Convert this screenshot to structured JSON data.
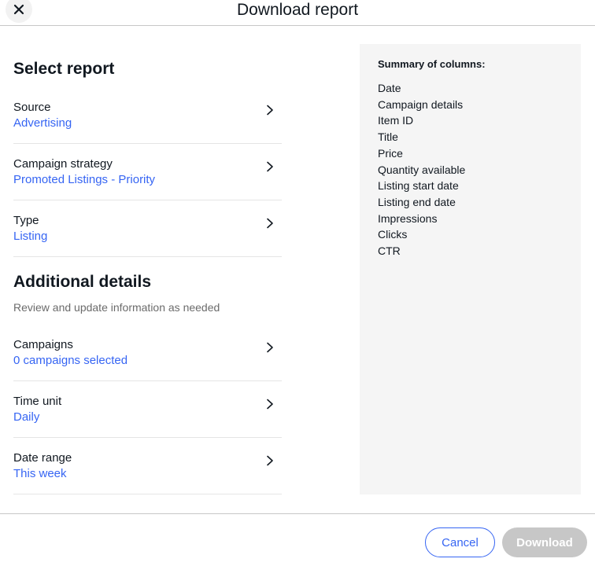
{
  "header": {
    "title": "Download report",
    "close_icon": "close-icon"
  },
  "select_report": {
    "title": "Select report",
    "rows": [
      {
        "label": "Source",
        "value": "Advertising"
      },
      {
        "label": "Campaign strategy",
        "value": "Promoted Listings - Priority"
      },
      {
        "label": "Type",
        "value": "Listing"
      }
    ]
  },
  "additional": {
    "title": "Additional details",
    "subtext": "Review and update information as needed",
    "rows": [
      {
        "label": "Campaigns",
        "value": "0 campaigns selected"
      },
      {
        "label": "Time unit",
        "value": "Daily"
      },
      {
        "label": "Date range",
        "value": "This week"
      }
    ]
  },
  "summary": {
    "title": "Summary of columns:",
    "columns": [
      "Date",
      "Campaign details",
      "Item ID",
      "Title",
      "Price",
      "Quantity available",
      "Listing start date",
      "Listing end date",
      "Impressions",
      "Clicks",
      "CTR"
    ]
  },
  "footer": {
    "cancel_label": "Cancel",
    "download_label": "Download"
  },
  "colors": {
    "accent": "#3665f3",
    "disabled": "#c7c7c7",
    "panel": "#f5f5f5"
  }
}
